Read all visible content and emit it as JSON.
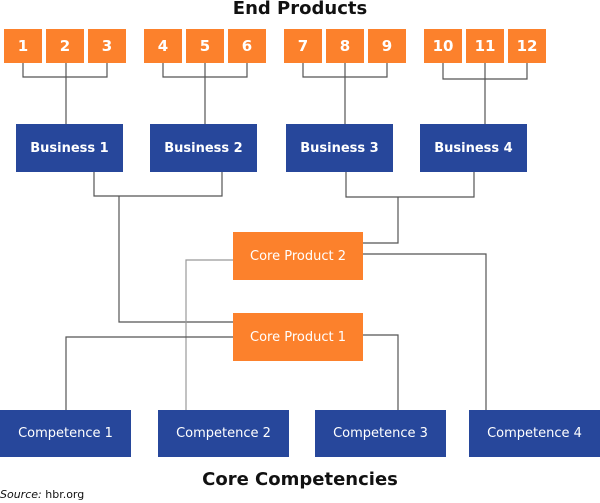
{
  "title_top": "End Products",
  "title_bottom": "Core Competencies",
  "source": {
    "label": "Source:",
    "value": "hbr.org"
  },
  "colors": {
    "end_product": "#fc812c",
    "core_product": "#fc812c",
    "business": "#27479b",
    "competence": "#27479b",
    "line": "#555555"
  },
  "end_products": [
    "1",
    "2",
    "3",
    "4",
    "5",
    "6",
    "7",
    "8",
    "9",
    "10",
    "11",
    "12"
  ],
  "businesses": [
    "Business 1",
    "Business 2",
    "Business 3",
    "Business 4"
  ],
  "core_products": [
    "Core Product 1",
    "Core Product 2"
  ],
  "competences": [
    "Competence 1",
    "Competence 2",
    "Competence 3",
    "Competence 4"
  ],
  "relations": {
    "end_products_to_business": {
      "Business 1": [
        "1",
        "2",
        "3"
      ],
      "Business 2": [
        "4",
        "5",
        "6"
      ],
      "Business 3": [
        "7",
        "8",
        "9"
      ],
      "Business 4": [
        "10",
        "11",
        "12"
      ]
    },
    "business_to_core_product": {
      "Core Product 1": [
        "Business 1",
        "Business 2"
      ],
      "Core Product 2": [
        "Business 3",
        "Business 4"
      ]
    },
    "core_product_to_competence": {
      "Core Product 1": [
        "Competence 1",
        "Competence 3"
      ],
      "Core Product 2": [
        "Competence 2",
        "Competence 4"
      ]
    }
  }
}
